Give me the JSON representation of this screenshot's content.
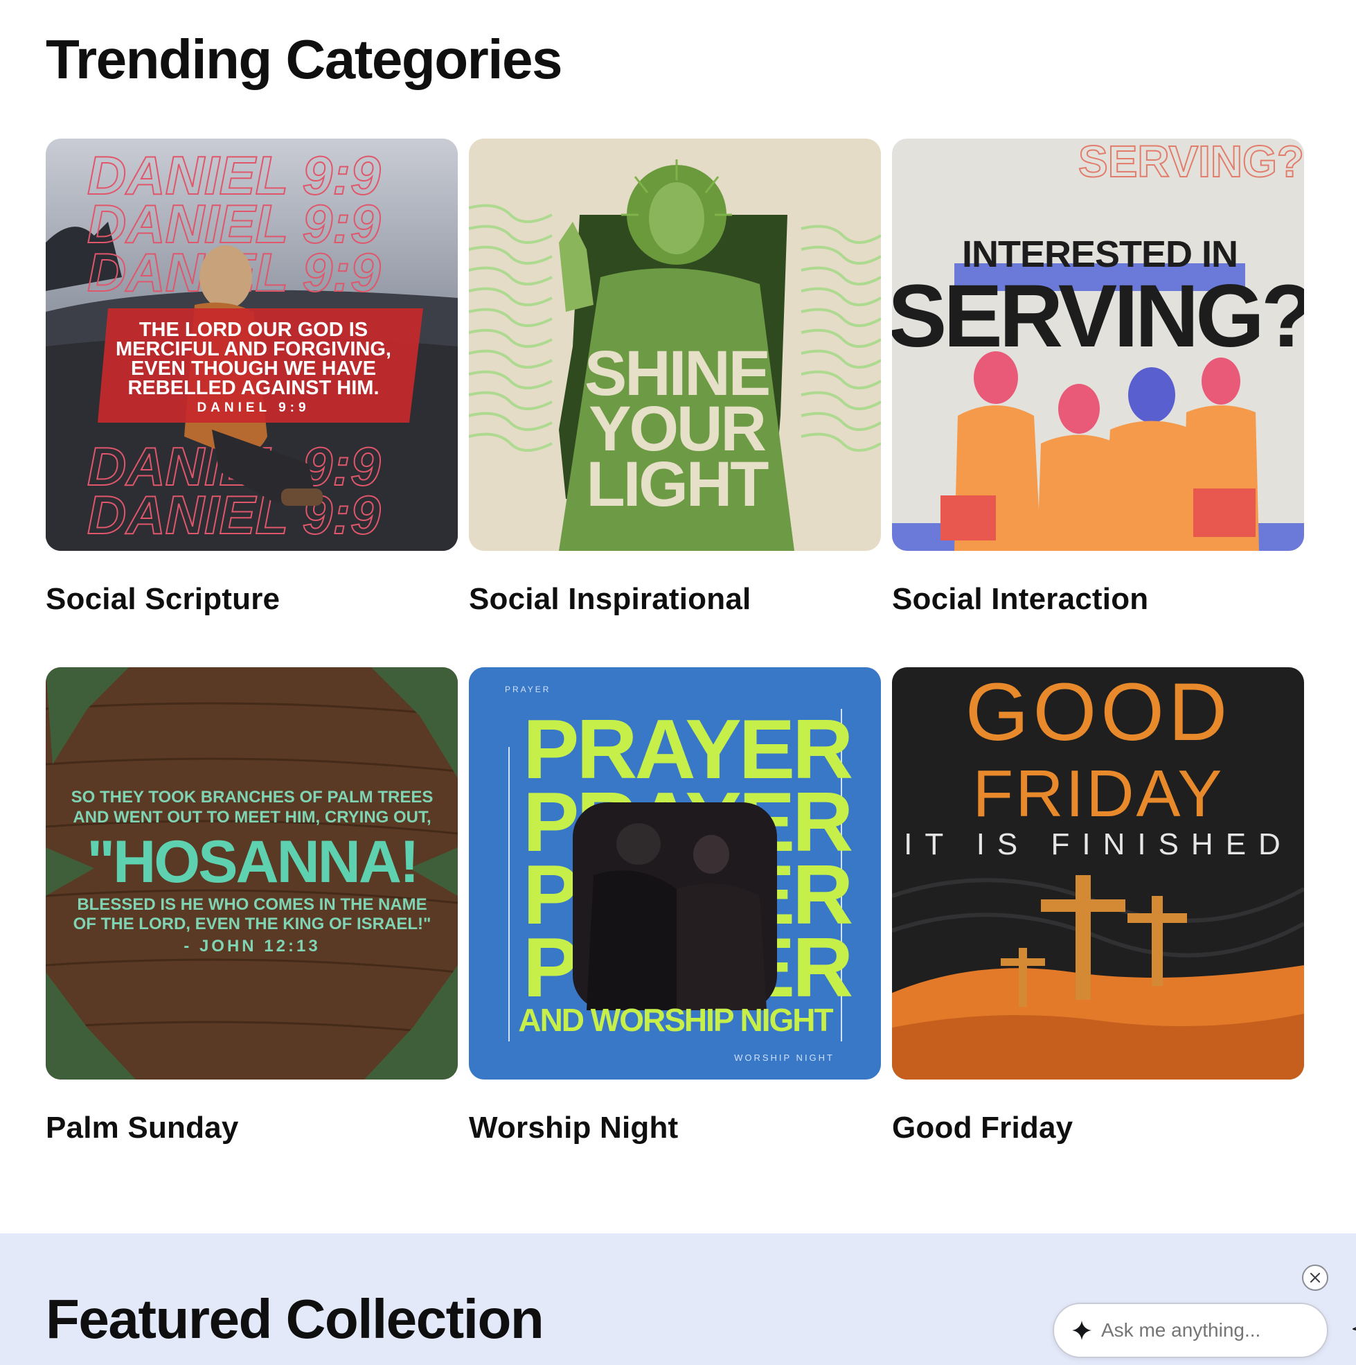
{
  "trending": {
    "title": "Trending Categories",
    "categories": [
      {
        "label": "Social Scripture",
        "art": {
          "repeat": "DANIEL 9:9",
          "lines": [
            "THE LORD OUR GOD IS",
            "MERCIFUL AND FORGIVING,",
            "EVEN THOUGH WE HAVE",
            "REBELLED AGAINST HIM."
          ],
          "ref": "DANIEL 9:9"
        }
      },
      {
        "label": "Social Inspirational",
        "art": {
          "lines": [
            "SHINE",
            "YOUR",
            "LIGHT"
          ]
        }
      },
      {
        "label": "Social Interaction",
        "art": {
          "top": "INTERESTED IN",
          "big": "SERVING?",
          "ghost": "SERVING?"
        }
      },
      {
        "label": "Palm Sunday",
        "art": {
          "lines": [
            "SO THEY TOOK BRANCHES OF PALM TREES",
            "AND WENT OUT TO MEET HIM, CRYING OUT,"
          ],
          "big": "\"HOSANNA!",
          "lines2": [
            "BLESSED IS HE WHO COMES IN THE NAME",
            "OF THE LORD, EVEN THE KING OF ISRAEL!\""
          ],
          "ref": "- JOHN 12:13"
        }
      },
      {
        "label": "Worship Night",
        "art": {
          "word": "PRAYER",
          "bottom": "AND WORSHIP NIGHT",
          "small": "WORSHIP NIGHT",
          "tiny": "PRAYER"
        }
      },
      {
        "label": "Good Friday",
        "art": {
          "line1": "GOOD",
          "line2": "FRIDAY",
          "line3": "IT IS FINISHED"
        }
      }
    ]
  },
  "featured": {
    "title": "Featured Collection"
  },
  "chat": {
    "placeholder": "Ask me anything..."
  },
  "icons": {
    "sparkle": "sparkle-icon",
    "send": "send-icon",
    "close": "close-icon"
  }
}
